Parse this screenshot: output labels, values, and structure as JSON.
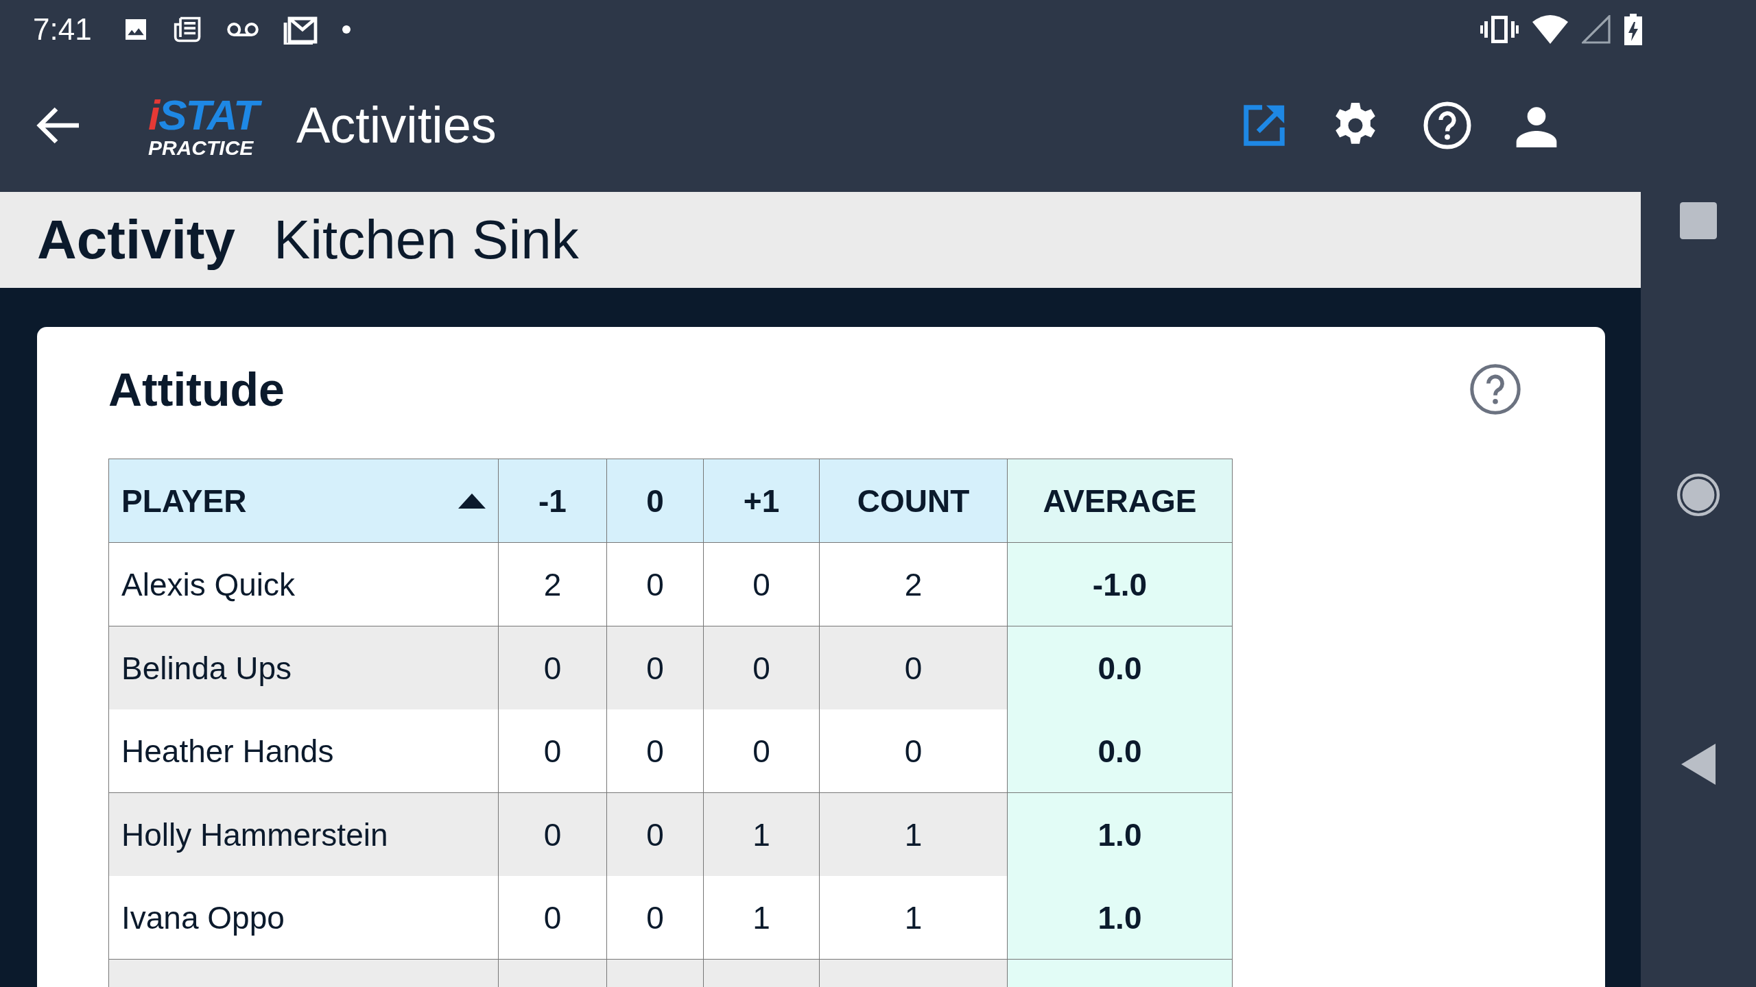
{
  "status_bar": {
    "time": "7:41"
  },
  "app_bar": {
    "logo": {
      "top": "iSTAT",
      "bottom": "PRACTICE"
    },
    "title": "Activities"
  },
  "activity": {
    "label": "Activity",
    "name": "Kitchen Sink"
  },
  "card": {
    "title": "Attitude",
    "table": {
      "columns": [
        {
          "label": "PLAYER",
          "sorted": true
        },
        {
          "label": "-1",
          "sorted": false
        },
        {
          "label": "0",
          "sorted": false
        },
        {
          "label": "+1",
          "sorted": false
        },
        {
          "label": "COUNT",
          "sorted": false
        },
        {
          "label": "AVERAGE",
          "sorted": false
        }
      ],
      "rows": [
        [
          "Alexis Quick",
          "2",
          "0",
          "0",
          "2",
          "-1.0"
        ],
        [
          "Belinda Ups",
          "0",
          "0",
          "0",
          "0",
          "0.0"
        ],
        [
          "Heather Hands",
          "0",
          "0",
          "0",
          "0",
          "0.0"
        ],
        [
          "Holly Hammerstein",
          "0",
          "0",
          "1",
          "1",
          "1.0"
        ],
        [
          "Ivana Oppo",
          "0",
          "0",
          "1",
          "1",
          "1.0"
        ]
      ]
    }
  }
}
